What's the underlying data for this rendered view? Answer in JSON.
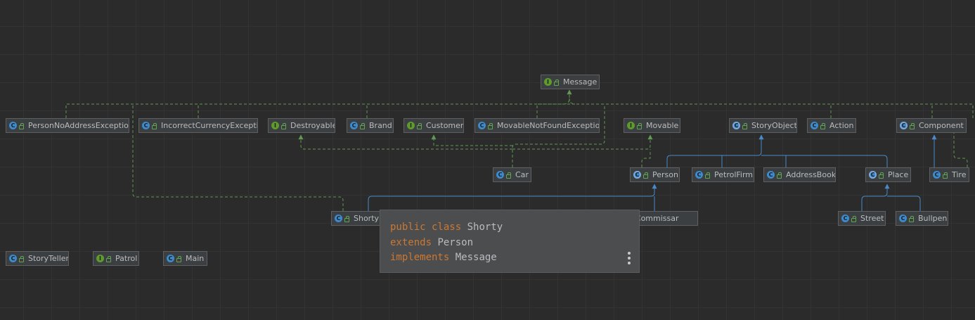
{
  "diagram": {
    "nodes": [
      {
        "id": "message",
        "label": "Message",
        "icon": "interface-icon"
      },
      {
        "id": "personnoaddress",
        "label": "PersonNoAddressException",
        "icon": "class-icon"
      },
      {
        "id": "incorrectcurrency",
        "label": "IncorrectCurrencyException",
        "icon": "class-icon"
      },
      {
        "id": "destroyable",
        "label": "Destroyable",
        "icon": "interface-icon"
      },
      {
        "id": "brand",
        "label": "Brand",
        "icon": "class-icon"
      },
      {
        "id": "customer",
        "label": "Customer",
        "icon": "interface-icon"
      },
      {
        "id": "movablenotfound",
        "label": "MovableNotFoundException",
        "icon": "class-icon"
      },
      {
        "id": "movable",
        "label": "Movable",
        "icon": "interface-icon"
      },
      {
        "id": "storyobject",
        "label": "StoryObject",
        "icon": "abstract-class-icon"
      },
      {
        "id": "action",
        "label": "Action",
        "icon": "class-icon"
      },
      {
        "id": "component",
        "label": "Component",
        "icon": "abstract-class-icon"
      },
      {
        "id": "car",
        "label": "Car",
        "icon": "class-icon"
      },
      {
        "id": "person",
        "label": "Person",
        "icon": "abstract-class-icon"
      },
      {
        "id": "petrolfirm",
        "label": "PetrolFirm",
        "icon": "class-icon"
      },
      {
        "id": "addressbook",
        "label": "AddressBook",
        "icon": "class-icon"
      },
      {
        "id": "place",
        "label": "Place",
        "icon": "abstract-class-icon"
      },
      {
        "id": "tire",
        "label": "Tire",
        "icon": "class-icon"
      },
      {
        "id": "shorty",
        "label": "Shorty",
        "icon": "class-icon"
      },
      {
        "id": "policecommissar",
        "label": "PoliceCommissar",
        "icon": "class-icon"
      },
      {
        "id": "street",
        "label": "Street",
        "icon": "class-icon"
      },
      {
        "id": "bullpen",
        "label": "Bullpen",
        "icon": "class-icon"
      },
      {
        "id": "storyteller",
        "label": "StoryTeller",
        "icon": "class-icon"
      },
      {
        "id": "patrol",
        "label": "Patrol",
        "icon": "interface-icon"
      },
      {
        "id": "main",
        "label": "Main",
        "icon": "main-class-icon"
      }
    ],
    "colors": {
      "background": "#2b2b2b",
      "implements_edge": "#629755",
      "extends_edge": "#4a88c7",
      "keyword": "#cc7832"
    }
  },
  "tooltip": {
    "line1_kw": "public class",
    "line1_name": "Shorty",
    "line2_kw": "extends",
    "line2_name": "Person",
    "line3_kw": "implements",
    "line3_name": "Message",
    "more_icon": "more-vertical-icon"
  }
}
